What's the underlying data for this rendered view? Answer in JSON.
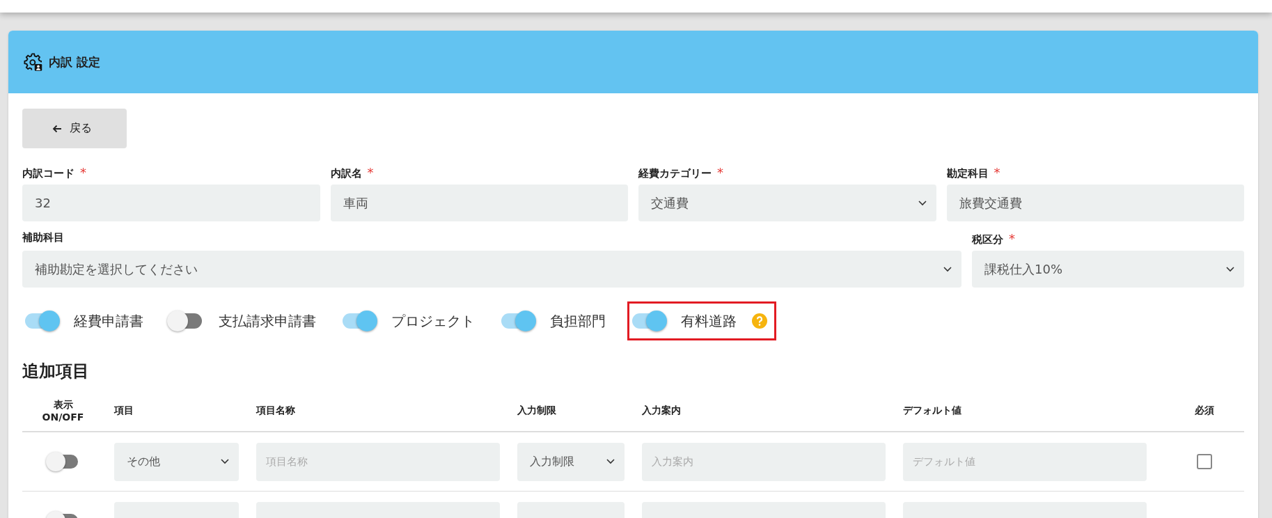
{
  "header": {
    "title": "内訳 設定"
  },
  "back_button": {
    "label": "戻る"
  },
  "fields_row1": [
    {
      "kind": "input",
      "label": "内訳コード",
      "required_mark": "*",
      "value": "32"
    },
    {
      "kind": "input",
      "label": "内訳名",
      "required_mark": "*",
      "value": "車両"
    },
    {
      "kind": "select",
      "label": "経費カテゴリー",
      "required_mark": "*",
      "value": "交通費"
    },
    {
      "kind": "input",
      "label": "勘定科目",
      "required_mark": "*",
      "value": "旅費交通費"
    }
  ],
  "fields_row2": [
    {
      "kind": "select",
      "label": "補助科目",
      "value": "補助勘定を選択してください"
    },
    {
      "kind": "select",
      "label": "税区分",
      "required_mark": "*",
      "value": "課税仕入10%"
    }
  ],
  "toggles": [
    {
      "label": "経費申請書",
      "on": true,
      "highlighted": false,
      "help": false
    },
    {
      "label": "支払請求申請書",
      "on": false,
      "highlighted": false,
      "help": false
    },
    {
      "label": "プロジェクト",
      "on": true,
      "highlighted": false,
      "help": false
    },
    {
      "label": "負担部門",
      "on": true,
      "highlighted": false,
      "help": false
    },
    {
      "label": "有料道路",
      "on": true,
      "highlighted": true,
      "help": true
    }
  ],
  "section_title": "追加項目",
  "table": {
    "columns": [
      "表示\nON/OFF",
      "項目",
      "項目名称",
      "入力制限",
      "入力案内",
      "デフォルト値",
      "必須"
    ],
    "rows": [
      {
        "display_on": false,
        "item": "その他",
        "name_placeholder": "項目名称",
        "restriction": "入力制限",
        "guide_placeholder": "入力案内",
        "default_placeholder": "デフォルト値",
        "required": false
      },
      {
        "display_on": false
      }
    ]
  }
}
